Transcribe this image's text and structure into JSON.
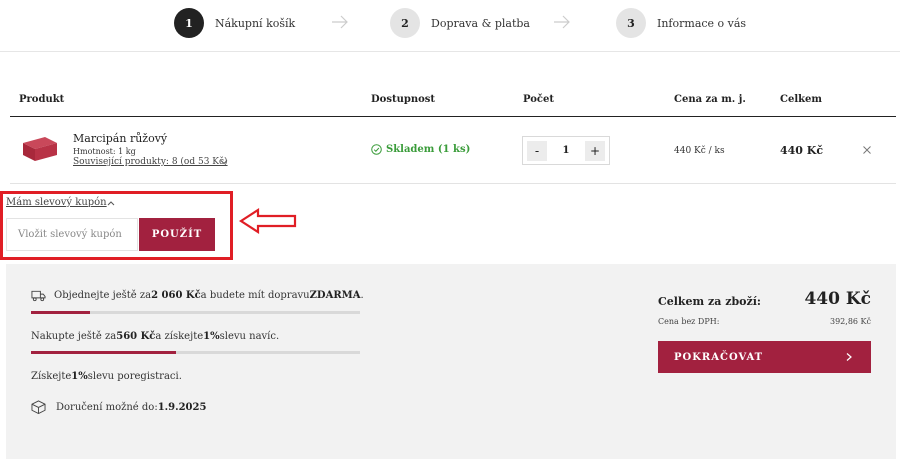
{
  "steps": [
    {
      "num": "1",
      "label": "Nákupní košík"
    },
    {
      "num": "2",
      "label": "Doprava & platba"
    },
    {
      "num": "3",
      "label": "Informace o vás"
    }
  ],
  "table": {
    "headers": {
      "product": "Produkt",
      "availability": "Dostupnost",
      "quantity": "Počet",
      "unit_price": "Cena za m. j.",
      "total": "Celkem"
    }
  },
  "item": {
    "name": "Marcipán růžový",
    "weight": "Hmotnost: 1 kg",
    "related": "Související produkty: 8 (od 53 Kč)",
    "availability": "Skladem (1 ks)",
    "qty_minus": "-",
    "qty": "1",
    "qty_plus": "+",
    "unit_price": "440 Kč / ks",
    "total": "440 Kč"
  },
  "coupon": {
    "toggle_label": "Mám slevový kupón",
    "input_placeholder": "Vložit slevový kupón",
    "apply_label": "POUŽÍT"
  },
  "summary": {
    "free_shipping": {
      "pre": "Objednejte ještě za ",
      "amount": "2 060 Kč",
      "mid": " a budete mít dopravu ",
      "strong": "ZDARMA",
      "post": "."
    },
    "free_shipping_progress": 0.18,
    "discount": {
      "pre": "Nakupte ještě za ",
      "amount": "560 Kč",
      "mid": " a získejte ",
      "pct": "1%",
      "post": " slevu navíc."
    },
    "discount_progress": 0.44,
    "registration": {
      "pre": "Získejte ",
      "pct": "1%",
      "mid": " slevu po ",
      "link": "registraci",
      "post": "."
    },
    "delivery": {
      "label": "Doručení možné do: ",
      "date": "1.9.2025"
    },
    "goods_total_label": "Celkem za zboží:",
    "goods_total": "440 Kč",
    "vat_label": "Cena bez DPH:",
    "vat_value": "392,86 Kč",
    "continue_label": "POKRAČOVAT"
  },
  "colors": {
    "accent": "#a2213f",
    "annotation": "#e01e25",
    "in_stock": "#3a9c3a"
  }
}
